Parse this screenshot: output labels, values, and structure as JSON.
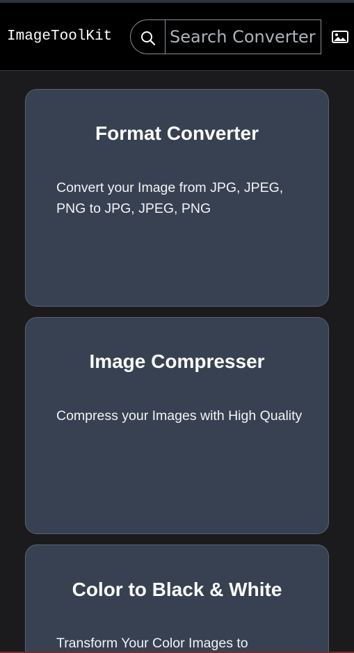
{
  "app": {
    "brand": "ImageToolKit"
  },
  "search": {
    "placeholder": "Search Converters...",
    "value": ""
  },
  "icons": {
    "search": "search-icon",
    "image": "image-icon"
  },
  "colors": {
    "navbar": "#000000",
    "page_background": "#1b1b1d",
    "card_background": "#374151",
    "card_border": "#5b6474",
    "text": "#ffffff"
  },
  "cards": [
    {
      "title": "Format Converter",
      "description": "Convert your Image from JPG, JPEG, PNG to JPG, JPEG, PNG"
    },
    {
      "title": "Image Compresser",
      "description": "Compress your Images with High Quality"
    },
    {
      "title": "Color to Black & White",
      "description": "Transform Your Color Images to"
    }
  ]
}
